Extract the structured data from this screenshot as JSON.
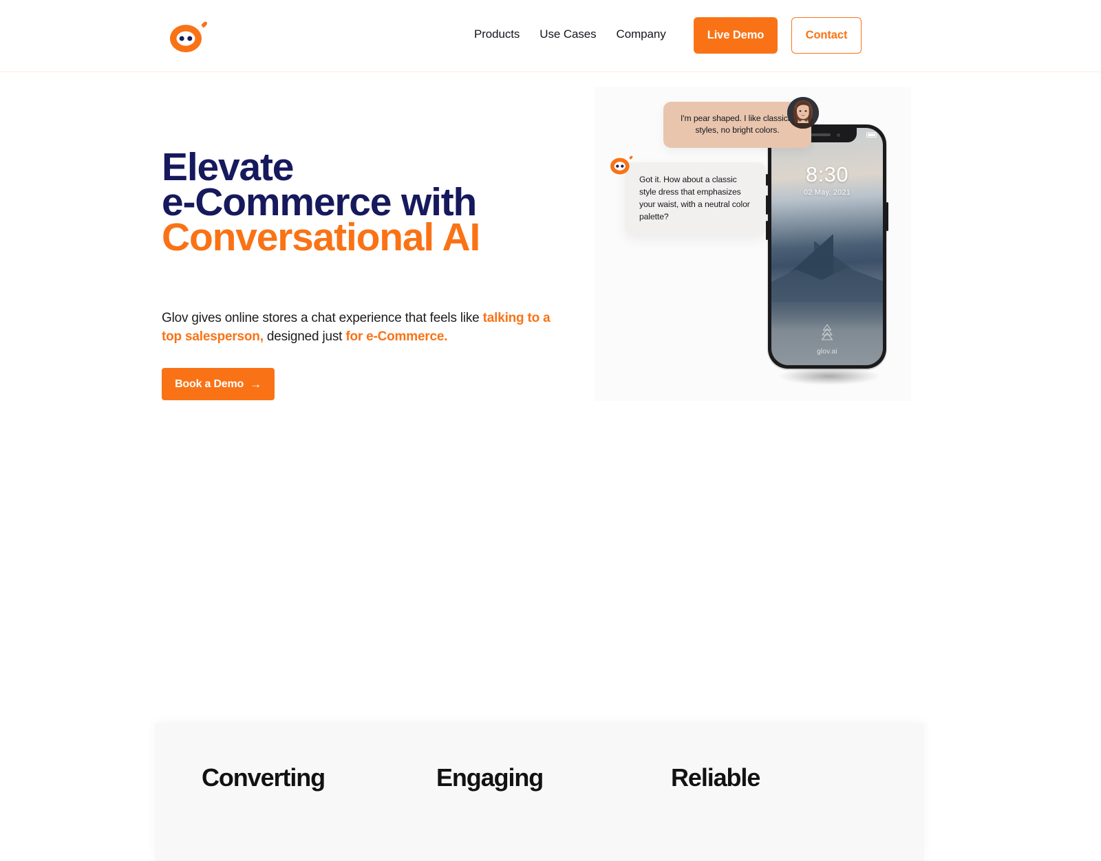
{
  "brand": {
    "logo_icon": "glov-bot-logo-icon",
    "accent_color": "#f97316",
    "navy_color": "#16195c"
  },
  "header": {
    "nav": [
      {
        "label": "Products"
      },
      {
        "label": "Use Cases"
      },
      {
        "label": "Company"
      }
    ],
    "live_demo_label": "Live Demo",
    "contact_label": "Contact"
  },
  "hero": {
    "title_line1": "Elevate",
    "title_line2": "e-Commerce with",
    "title_line3": "Conversational AI",
    "subtitle": {
      "part1": "Glov gives online stores a chat experience that feels like ",
      "highlight1": "talking to a top salesperson,",
      "part2": " designed just ",
      "highlight2": "for e-Commerce."
    },
    "cta_label": "Book a Demo",
    "cta_arrow": "→"
  },
  "hero_visual": {
    "user_message": "I'm pear shaped. I like classical styles, no bright colors.",
    "bot_message": "Got it. How about a classic style dress that emphasizes your waist, with a neutral color palette?",
    "bot_avatar_icon": "glov-bot-logo-icon",
    "user_avatar_icon": "woman-portrait-avatar",
    "phone": {
      "time": "8:30",
      "date": "02 May, 2021",
      "wallpaper_brand": "glov.ai",
      "wallpaper_icon": "pine-tree-icon",
      "battery_icon": "battery-icon",
      "notch_icon": "phone-notch-icon"
    }
  },
  "features": {
    "items": [
      {
        "title": "Converting"
      },
      {
        "title": "Engaging"
      },
      {
        "title": "Reliable"
      }
    ]
  }
}
